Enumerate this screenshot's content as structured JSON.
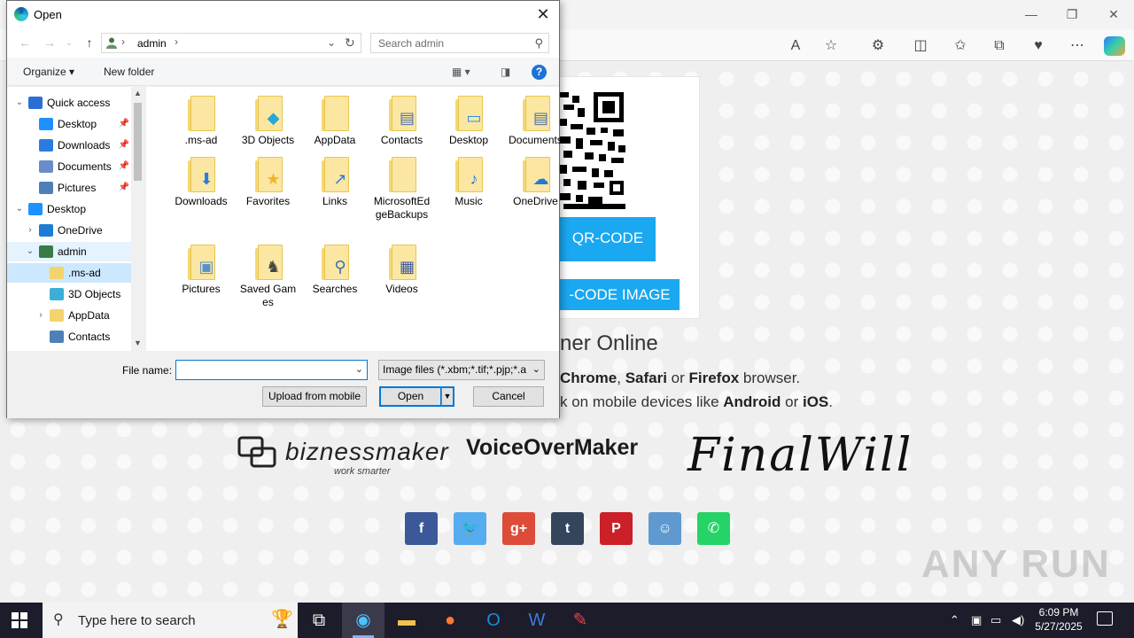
{
  "browser": {
    "controls": {
      "minimize": "—",
      "restore": "❐",
      "close": "✕"
    },
    "page": {
      "btn_qr": "QR-CODE",
      "btn_qr_image": "-CODE IMAGE",
      "heading": "ner Online",
      "line1": {
        "b1": "Chrome",
        "t1": ", ",
        "b2": "Safari",
        "t2": " or ",
        "b3": "Firefox",
        "t3": " browser."
      },
      "line2": {
        "t0": "k on mobile devices like ",
        "b1": "Android",
        "t1": " or ",
        "b2": "iOS",
        "t2": "."
      },
      "logos": {
        "biz": "biznessmaker",
        "biz_sub": "work smarter",
        "voice": "VoiceOverMaker",
        "final": "FinalWill"
      },
      "social": [
        {
          "name": "facebook",
          "glyph": "f",
          "color": "#3b5998"
        },
        {
          "name": "twitter",
          "glyph": "🐦",
          "color": "#55acee"
        },
        {
          "name": "google-plus",
          "glyph": "g+",
          "color": "#dd4b39"
        },
        {
          "name": "tumblr",
          "glyph": "t",
          "color": "#35465c"
        },
        {
          "name": "pinterest",
          "glyph": "P",
          "color": "#cb2027"
        },
        {
          "name": "reddit",
          "glyph": "☺",
          "color": "#5f99cf"
        },
        {
          "name": "whatsapp",
          "glyph": "✆",
          "color": "#25d366"
        }
      ],
      "watermark": "ANY RUN"
    }
  },
  "dialog": {
    "title": "Open",
    "address": {
      "crumb": "admin"
    },
    "search_placeholder": "Search admin",
    "commands": {
      "organize": "Organize ▾",
      "new_folder": "New folder",
      "help": "?"
    },
    "tree": [
      {
        "label": "Quick access",
        "chev": "⌄",
        "icon": "star",
        "pinned": false
      },
      {
        "label": "Desktop",
        "chev": "",
        "icon": "desktop",
        "pinned": true
      },
      {
        "label": "Downloads",
        "chev": "",
        "icon": "download",
        "pinned": true
      },
      {
        "label": "Documents",
        "chev": "",
        "icon": "document",
        "pinned": true
      },
      {
        "label": "Pictures",
        "chev": "",
        "icon": "picture",
        "pinned": true
      },
      {
        "label": "Desktop",
        "chev": "⌄",
        "icon": "desktop",
        "pinned": false
      },
      {
        "label": "OneDrive",
        "chev": "›",
        "icon": "cloud",
        "pinned": false
      },
      {
        "label": "admin",
        "chev": "⌄",
        "icon": "person",
        "pinned": false
      },
      {
        "label": ".ms-ad",
        "chev": "",
        "icon": "folder",
        "pinned": false
      },
      {
        "label": "3D Objects",
        "chev": "",
        "icon": "cube",
        "pinned": false
      },
      {
        "label": "AppData",
        "chev": "›",
        "icon": "folder",
        "pinned": false
      },
      {
        "label": "Contacts",
        "chev": "",
        "icon": "contacts",
        "pinned": false
      }
    ],
    "files": [
      {
        "label": ".ms-ad",
        "overlay": ""
      },
      {
        "label": "3D Objects",
        "overlay": "◆"
      },
      {
        "label": "AppData",
        "overlay": ""
      },
      {
        "label": "Contacts",
        "overlay": "▤"
      },
      {
        "label": "Desktop",
        "overlay": "▭"
      },
      {
        "label": "Documents",
        "overlay": "▤"
      },
      {
        "label": "Downloads",
        "overlay": "⬇"
      },
      {
        "label": "Favorites",
        "overlay": "★"
      },
      {
        "label": "Links",
        "overlay": "↗"
      },
      {
        "label": "MicrosoftEdgeBackups",
        "overlay": ""
      },
      {
        "label": "Music",
        "overlay": "♪"
      },
      {
        "label": "OneDrive",
        "overlay": "☁"
      },
      {
        "label": "Pictures",
        "overlay": "▣"
      },
      {
        "label": "Saved Games",
        "overlay": "♞"
      },
      {
        "label": "Searches",
        "overlay": "⚲"
      },
      {
        "label": "Videos",
        "overlay": "▦"
      }
    ],
    "file_name_label": "File name:",
    "file_name_value": "",
    "file_type": "Image files (*.xbm;*.tif;*.pjp;*.a",
    "buttons": {
      "upload": "Upload from mobile",
      "open": "Open",
      "cancel": "Cancel"
    }
  },
  "taskbar": {
    "search_placeholder": "Type here to search",
    "time": "6:09 PM",
    "date": "5/27/2025"
  },
  "colors": {
    "accent": "#0078d7",
    "page_button": "#1aa8f0",
    "taskbar": "#1c1c2a"
  }
}
